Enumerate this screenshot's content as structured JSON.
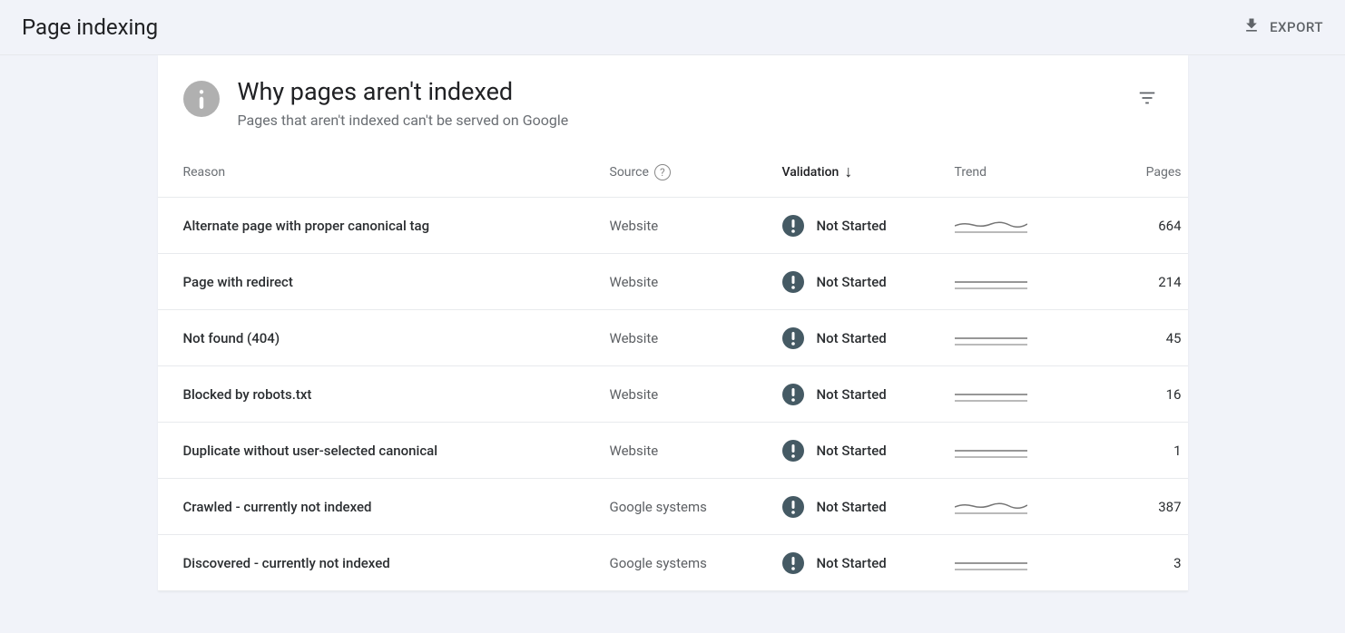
{
  "header": {
    "title": "Page indexing",
    "export_label": "EXPORT"
  },
  "card": {
    "title": "Why pages aren't indexed",
    "subtitle": "Pages that aren't indexed can't be served on Google"
  },
  "table": {
    "columns": {
      "reason": "Reason",
      "source": "Source",
      "validation": "Validation",
      "trend": "Trend",
      "pages": "Pages"
    },
    "rows": [
      {
        "reason": "Alternate page with proper canonical tag",
        "source": "Website",
        "validation": "Not Started",
        "pages": "664",
        "trend": "wavy"
      },
      {
        "reason": "Page with redirect",
        "source": "Website",
        "validation": "Not Started",
        "pages": "214",
        "trend": "flat"
      },
      {
        "reason": "Not found (404)",
        "source": "Website",
        "validation": "Not Started",
        "pages": "45",
        "trend": "flat"
      },
      {
        "reason": "Blocked by robots.txt",
        "source": "Website",
        "validation": "Not Started",
        "pages": "16",
        "trend": "flat"
      },
      {
        "reason": "Duplicate without user-selected canonical",
        "source": "Website",
        "validation": "Not Started",
        "pages": "1",
        "trend": "flat"
      },
      {
        "reason": "Crawled - currently not indexed",
        "source": "Google systems",
        "validation": "Not Started",
        "pages": "387",
        "trend": "wavy"
      },
      {
        "reason": "Discovered - currently not indexed",
        "source": "Google systems",
        "validation": "Not Started",
        "pages": "3",
        "trend": "flat"
      }
    ]
  }
}
